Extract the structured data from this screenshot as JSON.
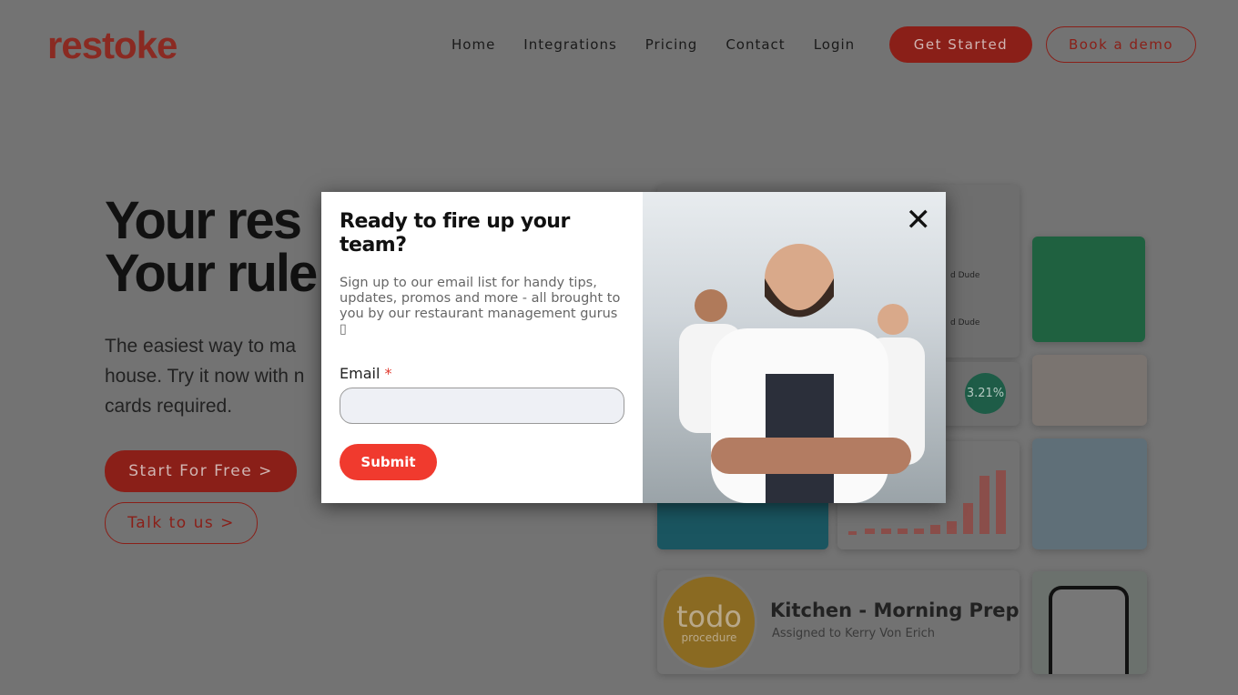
{
  "header": {
    "logo": "restoke",
    "nav": [
      "Home",
      "Integrations",
      "Pricing",
      "Contact",
      "Login"
    ],
    "get_started": "Get Started",
    "book_demo": "Book a demo"
  },
  "hero": {
    "title_line1": "Your res",
    "title_line2": "Your rule",
    "subtitle_lines": [
      "The easiest way to ma",
      "house. Try it now with n",
      "cards required."
    ],
    "start_free": "Start For Free >",
    "talk": "Talk to us >"
  },
  "collage": {
    "row1": "d Dude",
    "row2": "d Dude",
    "stat": "3.21%",
    "todo": "todo",
    "todo_sub": "procedure",
    "task_title": "Kitchen - Morning Prep",
    "task_assignee": "Assigned to Kerry Von Erich"
  },
  "modal": {
    "title": "Ready to fire up your team?",
    "text": "Sign up to our email list for handy tips, updates, promos and more - all brought to you by our restaurant management gurus ▯",
    "email_label": "Email",
    "required": "*",
    "email_value": "",
    "submit": "Submit",
    "close": "✕"
  },
  "colors": {
    "brand": "#f03a2e",
    "overlay": "rgba(0,0,0,0.55)",
    "stat_green": "#2e9e78",
    "todo_gold": "#e6b53c"
  }
}
